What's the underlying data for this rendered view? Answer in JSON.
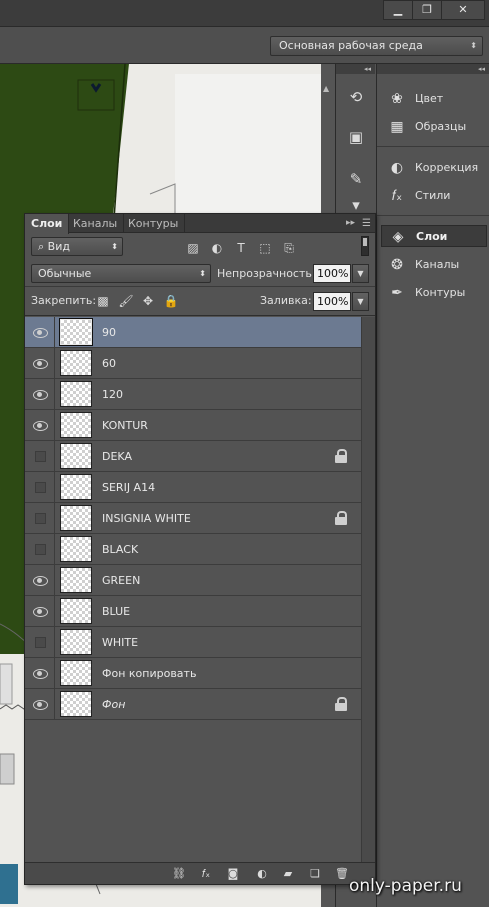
{
  "window": {
    "minimize_icon": "minimize-icon",
    "maximize_icon": "restore-icon",
    "close_icon": "close-icon"
  },
  "options_bar": {
    "workspace_value": "Основная рабочая среда"
  },
  "right_panels": {
    "groups": [
      {
        "items": [
          {
            "label": "Цвет",
            "icon": "palette-icon"
          },
          {
            "label": "Образцы",
            "icon": "swatches-grid-icon"
          }
        ]
      },
      {
        "items": [
          {
            "label": "Коррекция",
            "icon": "adjustment-circle-icon"
          },
          {
            "label": "Стили",
            "icon": "fx-styles-icon"
          }
        ]
      },
      {
        "items": [
          {
            "label": "Слои",
            "icon": "layers-stack-icon",
            "active": true
          },
          {
            "label": "Каналы",
            "icon": "channels-icon"
          },
          {
            "label": "Контуры",
            "icon": "paths-pen-icon"
          }
        ]
      }
    ]
  },
  "layers_panel": {
    "tabs": [
      "Слои",
      "Каналы",
      "Контуры"
    ],
    "active_tab": "Слои",
    "filter_kind": "Вид",
    "blend_mode": "Обычные",
    "opacity_label": "Непрозрачность:",
    "opacity_value": "100%",
    "lock_label": "Закрепить:",
    "fill_label": "Заливка:",
    "fill_value": "100%",
    "layers": [
      {
        "name": "90",
        "visible": true,
        "locked": false,
        "selected": true
      },
      {
        "name": "60",
        "visible": true,
        "locked": false
      },
      {
        "name": "120",
        "visible": true,
        "locked": false
      },
      {
        "name": "KONTUR",
        "visible": true,
        "locked": false
      },
      {
        "name": "DEKA",
        "visible": false,
        "locked": true
      },
      {
        "name": "SERIJ A14",
        "visible": false,
        "locked": false
      },
      {
        "name": "INSIGNIA WHITE",
        "visible": false,
        "locked": true
      },
      {
        "name": "BLACK",
        "visible": false,
        "locked": false
      },
      {
        "name": "GREEN",
        "visible": true,
        "locked": false
      },
      {
        "name": "BLUE",
        "visible": true,
        "locked": false
      },
      {
        "name": "WHITE",
        "visible": false,
        "locked": false
      },
      {
        "name": "Фон копировать",
        "visible": true,
        "locked": false
      },
      {
        "name": "Фон",
        "visible": true,
        "locked": true,
        "italic": true
      }
    ]
  },
  "watermark": "only-paper.ru",
  "colors": {
    "selected_layer": "#6c7a91",
    "panel_bg": "#535353",
    "canvas_green": "#2d4a14"
  }
}
